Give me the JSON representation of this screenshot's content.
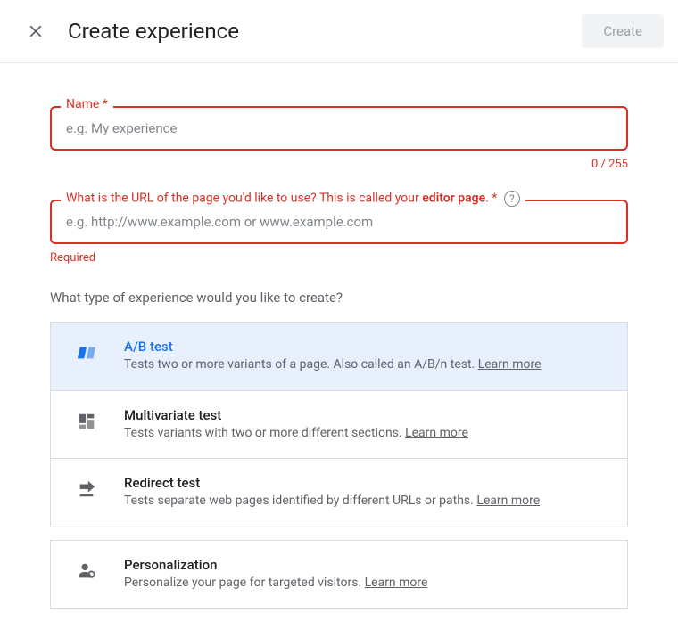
{
  "header": {
    "title": "Create experience",
    "create_label": "Create"
  },
  "name_field": {
    "label": "Name *",
    "placeholder": "e.g. My experience",
    "count": "0 / 255"
  },
  "url_field": {
    "label_prefix": "What is the URL of the page you'd like to use? This is called your ",
    "label_bold": "editor page",
    "label_suffix": ". *",
    "placeholder": "e.g. http://www.example.com or www.example.com",
    "error": "Required"
  },
  "type_section": {
    "heading": "What type of experience would you like to create?"
  },
  "options": {
    "ab": {
      "title": "A/B test",
      "desc": "Tests two or more variants of a page. Also called an A/B/n test. ",
      "learn": "Learn more"
    },
    "mvt": {
      "title": "Multivariate test",
      "desc": "Tests variants with two or more different sections. ",
      "learn": "Learn more"
    },
    "redirect": {
      "title": "Redirect test",
      "desc": "Tests separate web pages identified by different URLs or paths. ",
      "learn": "Learn more"
    },
    "personalization": {
      "title": "Personalization",
      "desc": "Personalize your page for targeted visitors. ",
      "learn": "Learn more"
    }
  }
}
